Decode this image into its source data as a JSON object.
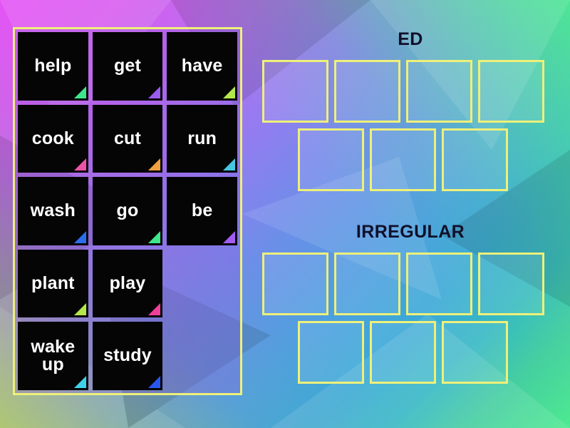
{
  "background": {
    "corner_colors": {
      "top_left": "#e455f5",
      "top_right": "#4dea90",
      "bottom_left": "#a8c45c",
      "bottom_right": "#2fa8d0"
    },
    "style": "low-poly gradient"
  },
  "theme": {
    "border_yellow": "#eef07a",
    "card_background": "#050505",
    "card_text": "#ffffff",
    "panel_fill": "rgba(140,90,220,0.30)",
    "heading_color": "#10102a"
  },
  "word_panel": {
    "name": "word-bank",
    "columns": 3,
    "rows": 5,
    "cards": [
      {
        "label": "help",
        "corner_color": "#3ee68c"
      },
      {
        "label": "get",
        "corner_color": "#9b5cf0"
      },
      {
        "label": "have",
        "corner_color": "#b4e84a"
      },
      {
        "label": "cook",
        "corner_color": "#ee52a8"
      },
      {
        "label": "cut",
        "corner_color": "#f0a040"
      },
      {
        "label": "run",
        "corner_color": "#45c8e0"
      },
      {
        "label": "wash",
        "corner_color": "#2a6ef0"
      },
      {
        "label": "go",
        "corner_color": "#3ee68c"
      },
      {
        "label": "be",
        "corner_color": "#a25cf0"
      },
      {
        "label": "plant",
        "corner_color": "#b4e84a"
      },
      {
        "label": "play",
        "corner_color": "#ee3f9b"
      },
      {
        "label": "",
        "corner_color": ""
      },
      {
        "label": "wake up",
        "corner_color": "#3fd2e8"
      },
      {
        "label": "study",
        "corner_color": "#2a56f0"
      },
      {
        "label": "",
        "corner_color": ""
      }
    ]
  },
  "zones": [
    {
      "id": "ed",
      "title": "ED",
      "rows": [
        {
          "slots": 4
        },
        {
          "slots": 3
        }
      ]
    },
    {
      "id": "irregular",
      "title": "IRREGULAR",
      "rows": [
        {
          "slots": 4
        },
        {
          "slots": 3
        }
      ]
    }
  ]
}
